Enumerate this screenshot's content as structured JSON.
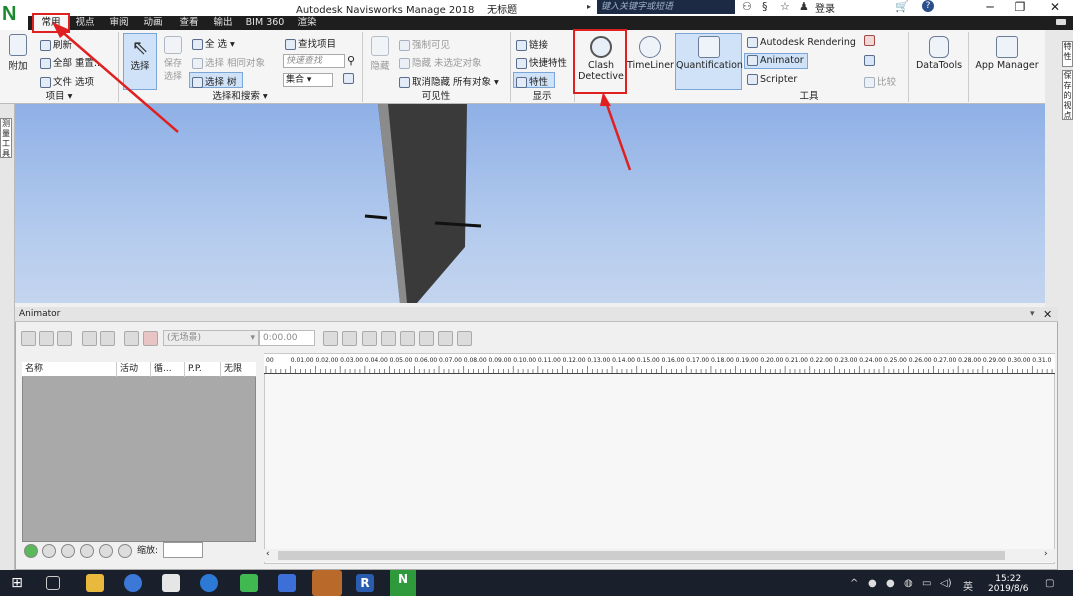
{
  "window": {
    "logo": "N",
    "title": "Autodesk Navisworks Manage 2018",
    "doc_title": "无标题",
    "search_placeholder": "键入关键字或短语",
    "login_label": "登录",
    "minimize": "─",
    "restore": "❐",
    "close": "✕"
  },
  "tabs": [
    "常用",
    "视点",
    "审阅",
    "动画",
    "查看",
    "输出",
    "BIM 360",
    "渲染"
  ],
  "ribbon": {
    "project": {
      "append": "附加",
      "refresh": "刷新",
      "reset_all": "全部 重置...",
      "file_options": "文件 选项",
      "group": "项目 ▾"
    },
    "select": {
      "select": "选择",
      "save_select": "保存选择",
      "select_all": "全 选",
      "select_same": "选择 相同对象",
      "select_tree": "选择 树",
      "find_items": "查找项目",
      "quick_find_placeholder": "快速查找",
      "sets": "集合",
      "group": "选择和搜索 ▾"
    },
    "visibility": {
      "hide": "隐藏",
      "force_visible": "强制可见",
      "hide_unselected": "隐藏 未选定对象",
      "unhide_all": "取消隐藏 所有对象",
      "group": "可见性"
    },
    "display": {
      "links": "链接",
      "quick_props": "快捷特性",
      "properties": "特性",
      "group": "显示"
    },
    "tools": {
      "clash_detective_1": "Clash",
      "clash_detective_2": "Detective",
      "timeliner": "TimeLiner",
      "quantification": "Quantification",
      "autodesk_rendering": "Autodesk Rendering",
      "animator": "Animator",
      "scripter": "Scripter",
      "compare": "比较",
      "datatools": "DataTools",
      "app_manager": "App Manager",
      "group": "工具"
    }
  },
  "side_labels": {
    "left": "测量工具",
    "right_top": "特性",
    "right_bottom": "保存的视点"
  },
  "animator": {
    "title": "Animator",
    "scene_select": "(无场景)",
    "time_value": "0:00.00",
    "columns": [
      "名称",
      "活动",
      "循...",
      "P.P.",
      "无限"
    ],
    "zoom_label": "缩放:",
    "ruler_labels": [
      "00",
      "0.01.00",
      "0.02.00",
      "0.03.00",
      "0.04.00",
      "0.05.00",
      "0.06.00",
      "0.07.00",
      "0.08.00",
      "0.09.00",
      "0.10.00",
      "0.11.00",
      "0.12.00",
      "0.13.00",
      "0.14.00",
      "0.15.00",
      "0.16.00",
      "0.17.00",
      "0.18.00",
      "0.19.00",
      "0.20.00",
      "0.21.00",
      "0.22.00",
      "0.23.00",
      "0.24.00",
      "0.25.00",
      "0.26.00",
      "0.27.00",
      "0.28.00",
      "0.29.00",
      "0.30.00",
      "0.31.0"
    ]
  },
  "taskbar": {
    "time": "15:22",
    "date": "2019/8/6",
    "ime": "英"
  },
  "colors": {
    "highlight_red": "#e02020",
    "ribbon_bg": "#f5f5f5",
    "tab_bar": "#1e1e1e",
    "viewport_sky": "#a8c2ec"
  }
}
